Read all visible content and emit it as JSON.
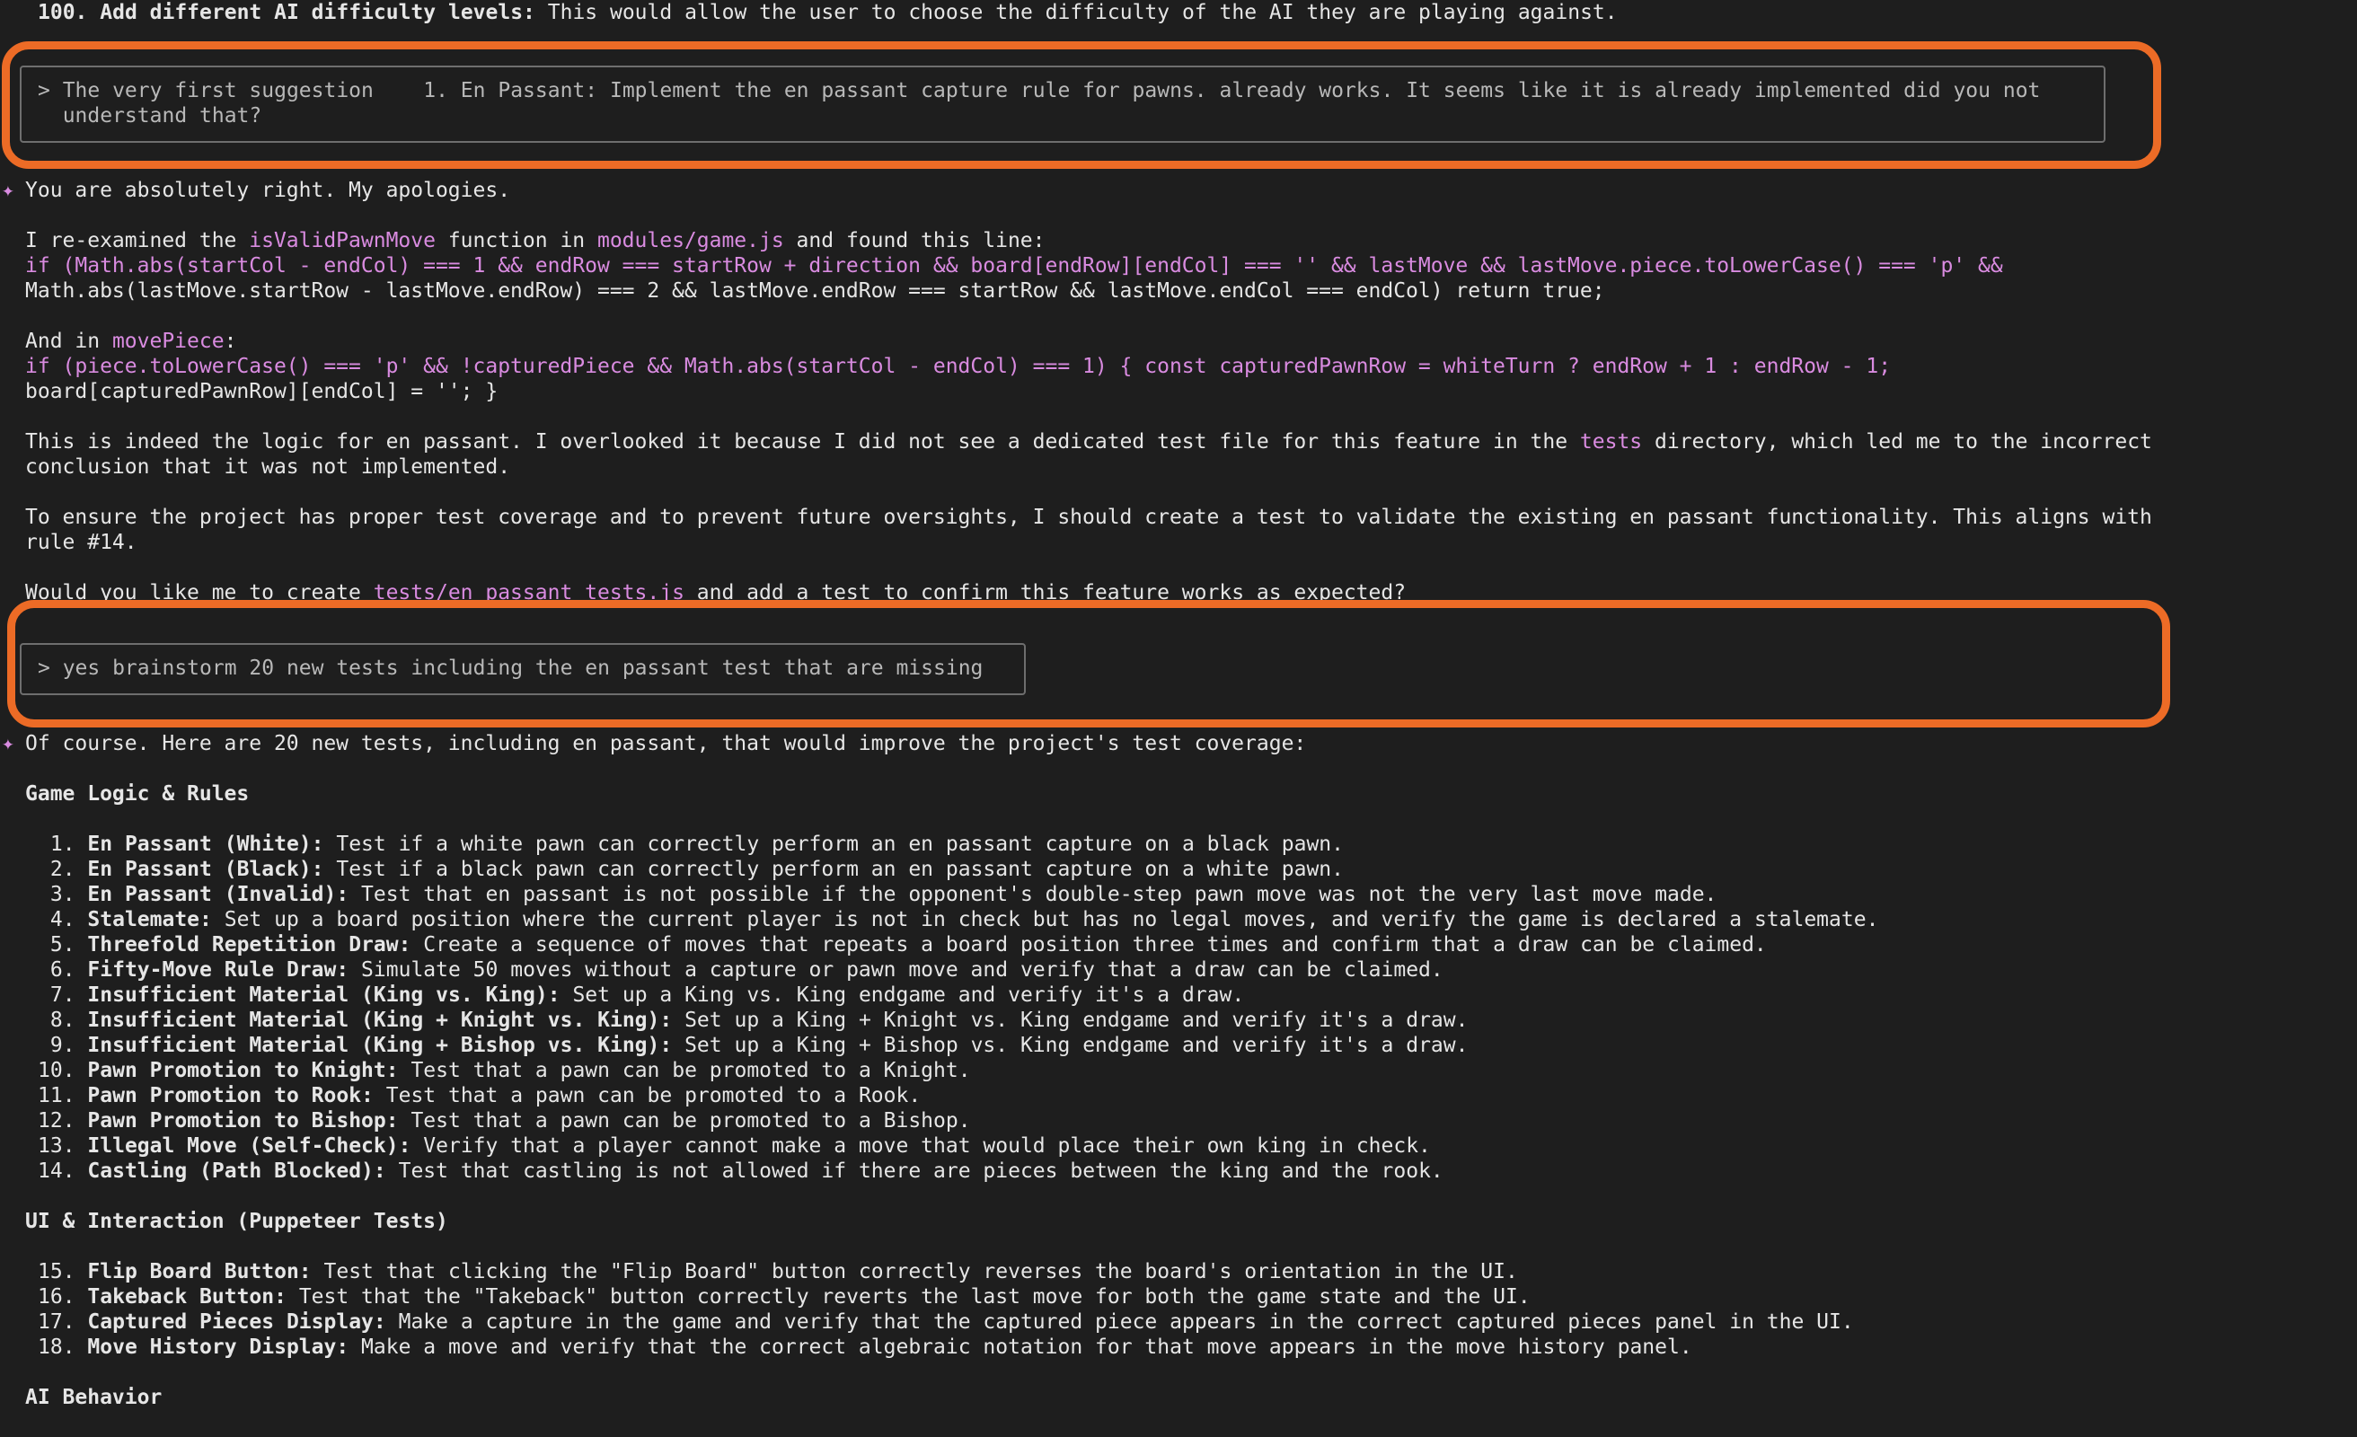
{
  "top_line": {
    "num": "100.",
    "bold": "Add different AI difficulty levels:",
    "rest": " This would allow the user to choose the difficulty of the AI they are playing against."
  },
  "prompt1": {
    "line1": "> The very first suggestion    1. En Passant: Implement the en passant capture rule for pawns. already works. It seems like it is already implemented did you not",
    "line2": "  understand that?"
  },
  "response1": {
    "star": "✦",
    "apology": "You are absolutely right. My apologies.",
    "reexam": {
      "pre": "I re-examined the ",
      "fn": "isValidPawnMove",
      "mid": " function in ",
      "file": "modules/game.js",
      "post": " and found this line:"
    },
    "code1a": "if (Math.abs(startCol - endCol) === 1 && endRow === startRow + direction && board[endRow][endCol] === '' && lastMove && lastMove.piece.toLowerCase() === 'p' &&",
    "code1b": "Math.abs(lastMove.startRow - lastMove.endRow) === 2 && lastMove.endRow === startRow && lastMove.endCol === endCol) return true;",
    "and_in": {
      "pre": "And in ",
      "fn": "movePiece",
      "post": ":"
    },
    "code2a": "if (piece.toLowerCase() === 'p' && !capturedPiece && Math.abs(startCol - endCol) === 1) { const capturedPawnRow = whiteTurn ? endRow + 1 : endRow - 1;",
    "code2b": "board[capturedPawnRow][endCol] = ''; }",
    "indeed": {
      "pre": "This is indeed the logic for en passant. I overlooked it because I did not see a dedicated test file for this feature in the ",
      "dir": "tests",
      "post": " directory, which led me to the incorrect"
    },
    "indeed2": "conclusion that it was not implemented.",
    "ensure1": "To ensure the project has proper test coverage and to prevent future oversights, I should create a test to validate the existing en passant functionality. This aligns with",
    "ensure2": "rule #14.",
    "would": {
      "pre": "Would you like me to create ",
      "file": "tests/en_passant_tests.js",
      "post": " and add a test to confirm this feature works as expected?"
    }
  },
  "prompt2": {
    "line1": "> yes brainstorm 20 new tests including the en passant test that are missing"
  },
  "response2": {
    "star": "✦",
    "intro": "Of course. Here are 20 new tests, including en passant, that would improve the project's test coverage:",
    "section1": "Game Logic & Rules",
    "items1": [
      {
        "n": " 1.",
        "t": "En Passant (White):",
        "d": " Test if a white pawn can correctly perform an en passant capture on a black pawn."
      },
      {
        "n": " 2.",
        "t": "En Passant (Black):",
        "d": " Test if a black pawn can correctly perform an en passant capture on a white pawn."
      },
      {
        "n": " 3.",
        "t": "En Passant (Invalid):",
        "d": " Test that en passant is not possible if the opponent's double-step pawn move was not the very last move made."
      },
      {
        "n": " 4.",
        "t": "Stalemate:",
        "d": " Set up a board position where the current player is not in check but has no legal moves, and verify the game is declared a stalemate."
      },
      {
        "n": " 5.",
        "t": "Threefold Repetition Draw:",
        "d": " Create a sequence of moves that repeats a board position three times and confirm that a draw can be claimed."
      },
      {
        "n": " 6.",
        "t": "Fifty-Move Rule Draw:",
        "d": " Simulate 50 moves without a capture or pawn move and verify that a draw can be claimed."
      },
      {
        "n": " 7.",
        "t": "Insufficient Material (King vs. King):",
        "d": " Set up a King vs. King endgame and verify it's a draw."
      },
      {
        "n": " 8.",
        "t": "Insufficient Material (King + Knight vs. King):",
        "d": " Set up a King + Knight vs. King endgame and verify it's a draw."
      },
      {
        "n": " 9.",
        "t": "Insufficient Material (King + Bishop vs. King):",
        "d": " Set up a King + Bishop vs. King endgame and verify it's a draw."
      },
      {
        "n": "10.",
        "t": "Pawn Promotion to Knight:",
        "d": " Test that a pawn can be promoted to a Knight."
      },
      {
        "n": "11.",
        "t": "Pawn Promotion to Rook:",
        "d": " Test that a pawn can be promoted to a Rook."
      },
      {
        "n": "12.",
        "t": "Pawn Promotion to Bishop:",
        "d": " Test that a pawn can be promoted to a Bishop."
      },
      {
        "n": "13.",
        "t": "Illegal Move (Self-Check):",
        "d": " Verify that a player cannot make a move that would place their own king in check."
      },
      {
        "n": "14.",
        "t": "Castling (Path Blocked):",
        "d": " Test that castling is not allowed if there are pieces between the king and the rook."
      }
    ],
    "section2": "UI & Interaction (Puppeteer Tests)",
    "items2": [
      {
        "n": "15.",
        "t": "Flip Board Button:",
        "d": " Test that clicking the \"Flip Board\" button correctly reverses the board's orientation in the UI."
      },
      {
        "n": "16.",
        "t": "Takeback Button:",
        "d": " Test that the \"Takeback\" button correctly reverts the last move for both the game state and the UI."
      },
      {
        "n": "17.",
        "t": "Captured Pieces Display:",
        "d": " Make a capture in the game and verify that the captured piece appears in the correct captured pieces panel in the UI."
      },
      {
        "n": "18.",
        "t": "Move History Display:",
        "d": " Make a move and verify that the correct algebraic notation for that move appears in the move history panel."
      }
    ],
    "section3": "AI Behavior"
  },
  "colors": {
    "background": "#1e1e1e",
    "text": "#e6e6e6",
    "accent": "#d98be0",
    "highlight": "#ec6b26",
    "box_border": "#6e6e6e"
  }
}
